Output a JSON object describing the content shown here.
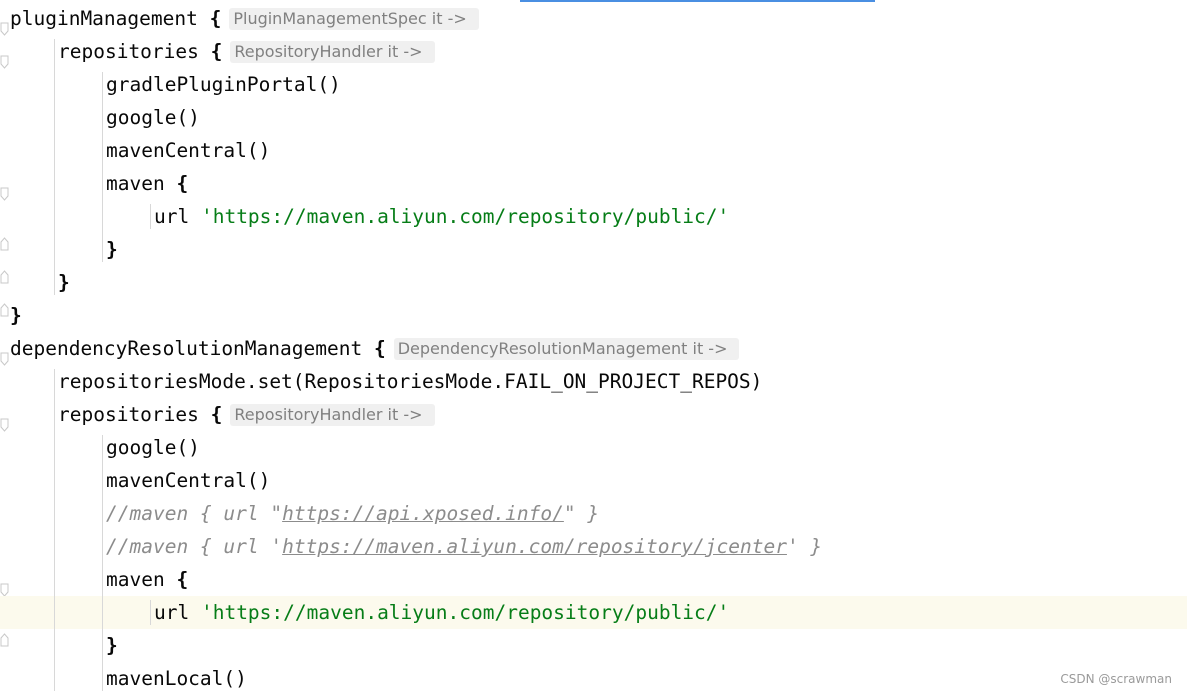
{
  "editor": {
    "lines": [
      {
        "indent": 0,
        "tokens": [
          {
            "t": "pluginManagement ",
            "c": "kw"
          },
          {
            "t": "{",
            "c": "brace"
          }
        ],
        "hint": "PluginManagementSpec it ->"
      },
      {
        "indent": 1,
        "tokens": [
          {
            "t": "repositories ",
            "c": "kw"
          },
          {
            "t": "{",
            "c": "brace"
          }
        ],
        "hint": "RepositoryHandler it ->"
      },
      {
        "indent": 2,
        "tokens": [
          {
            "t": "gradlePluginPortal()",
            "c": "kw"
          }
        ]
      },
      {
        "indent": 2,
        "tokens": [
          {
            "t": "google()",
            "c": "kw"
          }
        ]
      },
      {
        "indent": 2,
        "tokens": [
          {
            "t": "mavenCentral()",
            "c": "kw"
          }
        ]
      },
      {
        "indent": 2,
        "tokens": [
          {
            "t": "maven ",
            "c": "kw"
          },
          {
            "t": "{",
            "c": "brace"
          }
        ]
      },
      {
        "indent": 3,
        "tokens": [
          {
            "t": "url ",
            "c": "kw"
          },
          {
            "t": "'https://maven.aliyun.com/repository/public/'",
            "c": "str"
          }
        ]
      },
      {
        "indent": 2,
        "tokens": [
          {
            "t": "}",
            "c": "brace"
          }
        ]
      },
      {
        "indent": 1,
        "tokens": [
          {
            "t": "}",
            "c": "brace"
          }
        ]
      },
      {
        "indent": 0,
        "tokens": [
          {
            "t": "}",
            "c": "brace"
          }
        ]
      },
      {
        "indent": 0,
        "tokens": [
          {
            "t": "dependencyResolutionManagement ",
            "c": "kw"
          },
          {
            "t": "{",
            "c": "brace"
          }
        ],
        "hint": "DependencyResolutionManagement it ->"
      },
      {
        "indent": 1,
        "tokens": [
          {
            "t": "repositoriesMode.set(RepositoriesMode.FAIL_ON_PROJECT_REPOS)",
            "c": "kw"
          }
        ]
      },
      {
        "indent": 1,
        "tokens": [
          {
            "t": "repositories ",
            "c": "kw"
          },
          {
            "t": "{",
            "c": "brace"
          }
        ],
        "hint": "RepositoryHandler it ->"
      },
      {
        "indent": 2,
        "tokens": [
          {
            "t": "google()",
            "c": "kw"
          }
        ]
      },
      {
        "indent": 2,
        "tokens": [
          {
            "t": "mavenCentral()",
            "c": "kw"
          }
        ]
      },
      {
        "indent": 2,
        "tokens": [
          {
            "t": "//maven { url \"",
            "c": "comment"
          },
          {
            "t": "https://api.xposed.info/",
            "c": "comment link"
          },
          {
            "t": "\" }",
            "c": "comment"
          }
        ]
      },
      {
        "indent": 2,
        "tokens": [
          {
            "t": "//maven { url '",
            "c": "comment"
          },
          {
            "t": "https://maven.aliyun.com/repository/jcenter",
            "c": "comment link"
          },
          {
            "t": "' }",
            "c": "comment"
          }
        ]
      },
      {
        "indent": 2,
        "tokens": [
          {
            "t": "maven ",
            "c": "kw"
          },
          {
            "t": "{",
            "c": "brace"
          }
        ]
      },
      {
        "indent": 3,
        "tokens": [
          {
            "t": "url ",
            "c": "kw"
          },
          {
            "t": "'https://maven.aliyun.com/repository/public/'",
            "c": "str"
          }
        ],
        "current": true
      },
      {
        "indent": 2,
        "tokens": [
          {
            "t": "}",
            "c": "brace"
          }
        ]
      },
      {
        "indent": 2,
        "tokens": [
          {
            "t": "mavenLocal()",
            "c": "kw"
          }
        ]
      }
    ]
  },
  "colors": {
    "string": "#067d17",
    "comment": "#8c8c8c",
    "current_line": "#fcfaed",
    "accent": "#4a8fe2"
  },
  "watermark": "CSDN @scrawman"
}
